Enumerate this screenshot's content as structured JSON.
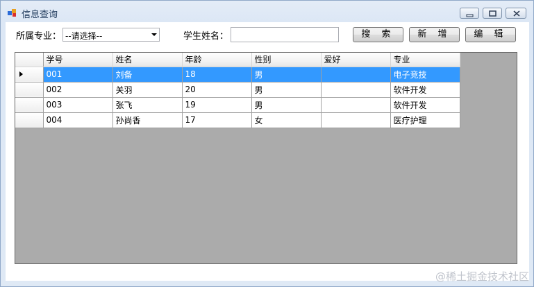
{
  "window": {
    "title": "信息查询"
  },
  "toolbar": {
    "major_label": "所属专业：",
    "major_select_value": "--请选择--",
    "name_label": "学生姓名：",
    "name_input_value": "",
    "search_label": "搜 索",
    "add_label": "新 增",
    "edit_label": "编 辑"
  },
  "table": {
    "columns": [
      "学号",
      "姓名",
      "年龄",
      "性别",
      "爱好",
      "专业"
    ],
    "rows": [
      [
        "001",
        "刘备",
        "18",
        "男",
        "",
        "电子竞技"
      ],
      [
        "002",
        "关羽",
        "20",
        "男",
        "",
        "软件开发"
      ],
      [
        "003",
        "张飞",
        "19",
        "男",
        "",
        "软件开发"
      ],
      [
        "004",
        "孙尚香",
        "17",
        "女",
        "",
        "医疗护理"
      ]
    ],
    "selected_row": 0
  },
  "watermark": "@稀土掘金技术社区",
  "icons": {
    "app": "app-icon",
    "minimize": "minimize-icon",
    "maximize": "maximize-icon",
    "close": "close-icon",
    "dropdown": "chevron-down-icon",
    "row_indicator": "row-arrow-icon"
  }
}
